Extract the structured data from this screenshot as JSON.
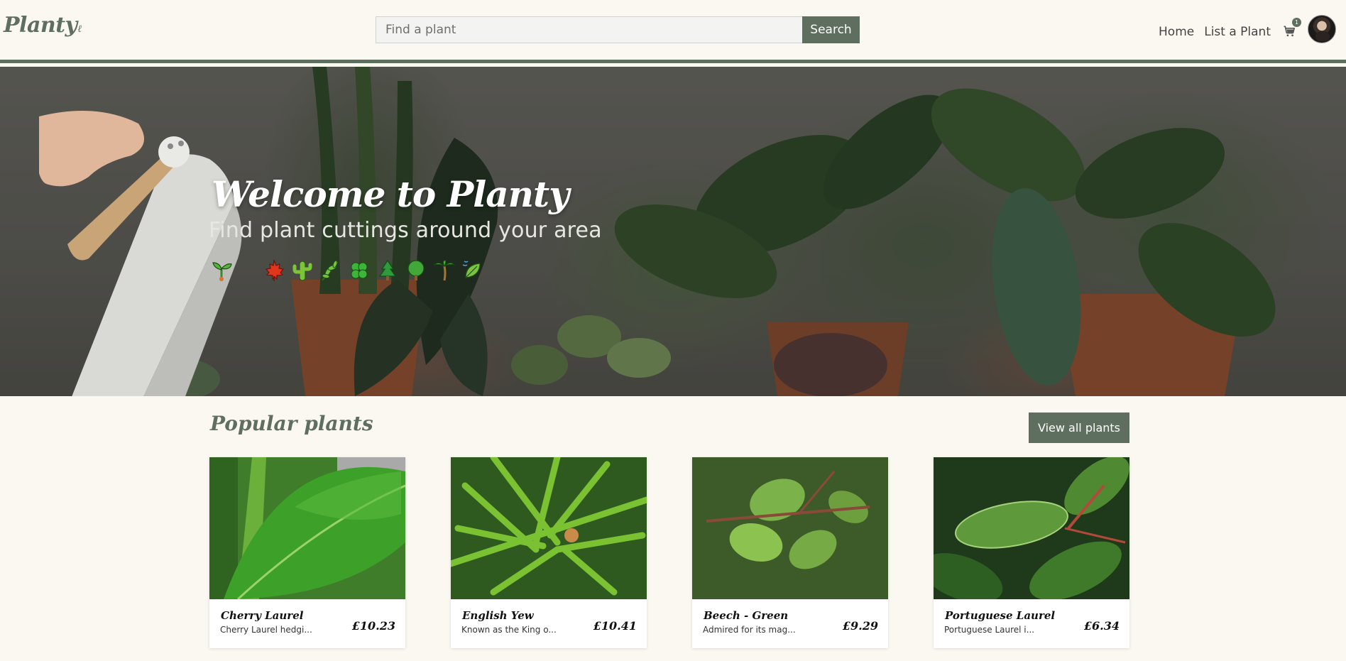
{
  "header": {
    "brand": "Planty",
    "search_placeholder": "Find a plant",
    "search_value": "",
    "search_label": "Search",
    "nav": [
      {
        "label": "Home"
      },
      {
        "label": "List a Plant"
      }
    ],
    "cart_icon": "cart-icon",
    "cart_count": "1",
    "avatar_icon": "user-avatar"
  },
  "hero": {
    "title": "Welcome to Planty",
    "subtitle": "Find plant cuttings around your area",
    "emojis": [
      "seedling-emoji",
      "maple-leaf-emoji",
      "cactus-emoji",
      "herb-emoji",
      "four-leaf-clover-emoji",
      "evergreen-tree-emoji",
      "deciduous-tree-emoji",
      "palm-tree-emoji",
      "leaf-fluttering-emoji"
    ]
  },
  "popular": {
    "title": "Popular plants",
    "view_all_label": "View all plants",
    "cards": [
      {
        "name": "Cherry Laurel",
        "desc": "Cherry Laurel hedgi...",
        "price": "£10.23"
      },
      {
        "name": "English Yew",
        "desc": "Known as the King o...",
        "price": "£10.41"
      },
      {
        "name": "Beech - Green",
        "desc": "Admired for its mag...",
        "price": "£9.29"
      },
      {
        "name": "Portuguese Laurel",
        "desc": "Portuguese Laurel i...",
        "price": "£6.34"
      }
    ]
  },
  "colors": {
    "accent": "#5f6f5f",
    "background": "#fbf8f1"
  }
}
